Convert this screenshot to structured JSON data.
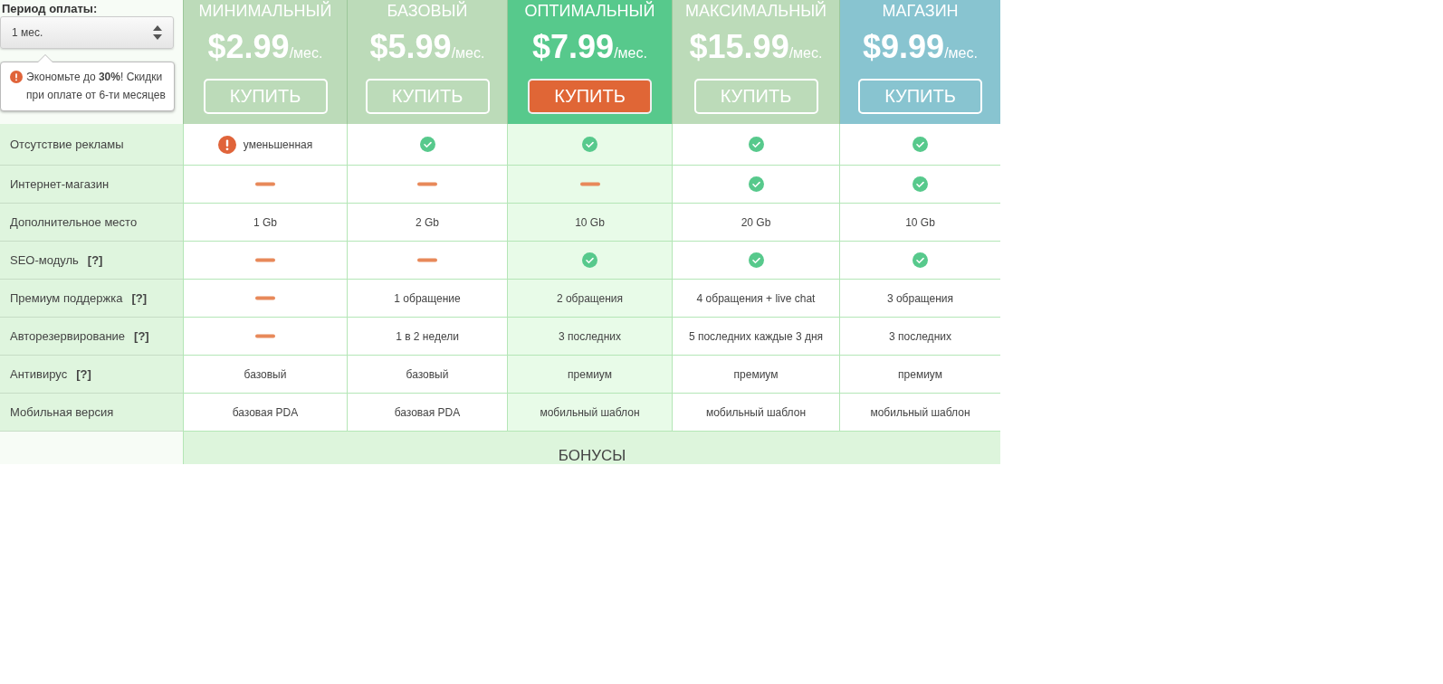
{
  "period": {
    "label": "Период оплаты:",
    "value": "1 мес.",
    "tip": "Экономьте до **30%**! Скидки при оплате от 6-ти месяцев"
  },
  "plans": [
    {
      "name": "МИНИМАЛЬНЫЙ",
      "price": "$2.99",
      "unit": "/мес.",
      "button": "КУПИТЬ",
      "color": "#bcdbb9",
      "highlighted": false
    },
    {
      "name": "БАЗОВЫЙ",
      "price": "$5.99",
      "unit": "/мес.",
      "button": "КУПИТЬ",
      "color": "#bcdbb9",
      "highlighted": false
    },
    {
      "name": "ОПТИМАЛЬНЫЙ",
      "price": "$7.99",
      "unit": "/мес.",
      "button": "КУПИТЬ",
      "color": "#57c98c",
      "highlighted": true
    },
    {
      "name": "МАКСИМАЛЬНЫЙ",
      "price": "$15.99",
      "unit": "/мес.",
      "button": "КУПИТЬ",
      "color": "#bcdbb9",
      "highlighted": false
    },
    {
      "name": "МАГАЗИН",
      "price": "$9.99",
      "unit": "/мес.",
      "button": "КУПИТЬ",
      "color": "#88c4d0",
      "highlighted": false
    }
  ],
  "features": [
    {
      "label": "Отсутствие рекламы",
      "values": [
        {
          "kind": "partial",
          "text": "уменьшенная"
        },
        {
          "kind": "yes"
        },
        {
          "kind": "yes"
        },
        {
          "kind": "yes"
        },
        {
          "kind": "yes"
        }
      ]
    },
    {
      "label": "Интернет-магазин",
      "values": [
        {
          "kind": "no"
        },
        {
          "kind": "no"
        },
        {
          "kind": "no"
        },
        {
          "kind": "yes"
        },
        {
          "kind": "yes"
        }
      ]
    },
    {
      "label": "Дополнительное место",
      "values": [
        {
          "kind": "text",
          "text": "1 Gb"
        },
        {
          "kind": "text",
          "text": "2 Gb"
        },
        {
          "kind": "text",
          "text": "10 Gb"
        },
        {
          "kind": "text",
          "text": "20 Gb"
        },
        {
          "kind": "text",
          "text": "10 Gb"
        }
      ]
    },
    {
      "label": "SEO-модуль",
      "help": "[?]",
      "values": [
        {
          "kind": "no"
        },
        {
          "kind": "no"
        },
        {
          "kind": "yes"
        },
        {
          "kind": "yes"
        },
        {
          "kind": "yes"
        }
      ]
    },
    {
      "label": "Премиум поддержка",
      "help": "[?]",
      "values": [
        {
          "kind": "no"
        },
        {
          "kind": "text",
          "text": "1 обращение"
        },
        {
          "kind": "text",
          "text": "2 обращения"
        },
        {
          "kind": "text",
          "text": "4 обращения + live chat"
        },
        {
          "kind": "text",
          "text": "3 обращения"
        }
      ]
    },
    {
      "label": "Авторезервирование",
      "help": "[?]",
      "values": [
        {
          "kind": "no"
        },
        {
          "kind": "text",
          "text": "1 в 2 недели"
        },
        {
          "kind": "text",
          "text": "3 последних"
        },
        {
          "kind": "text",
          "text": "5 последних каждые 3 дня"
        },
        {
          "kind": "text",
          "text": "3 последних"
        }
      ]
    },
    {
      "label": "Антивирус",
      "help": "[?]",
      "values": [
        {
          "kind": "text",
          "text": "базовый"
        },
        {
          "kind": "text",
          "text": "базовый"
        },
        {
          "kind": "text",
          "text": "премиум"
        },
        {
          "kind": "text",
          "text": "премиум"
        },
        {
          "kind": "text",
          "text": "премиум"
        }
      ]
    },
    {
      "label": "Мобильная версия",
      "values": [
        {
          "kind": "text",
          "text": "базовая PDA"
        },
        {
          "kind": "text",
          "text": "базовая PDA"
        },
        {
          "kind": "text",
          "text": "мобильный шаблон"
        },
        {
          "kind": "text",
          "text": "мобильный шаблон"
        },
        {
          "kind": "text",
          "text": "мобильный шаблон"
        }
      ]
    }
  ],
  "bonus": {
    "title": "БОНУСЫ"
  }
}
